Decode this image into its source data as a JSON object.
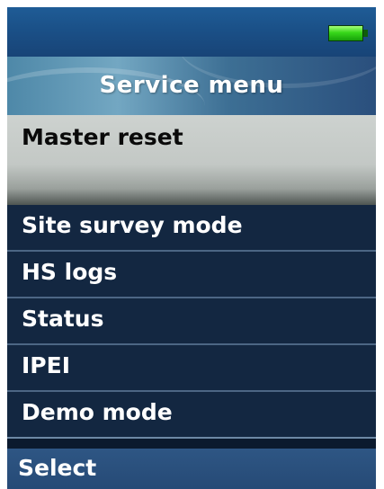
{
  "status_bar": {
    "battery_icon": "battery-full-icon",
    "battery_color": "#38d81a"
  },
  "title_bar": {
    "title": "Service menu"
  },
  "menu": {
    "selected": {
      "label": "Master reset"
    },
    "items": [
      {
        "label": "Site survey mode"
      },
      {
        "label": "HS logs"
      },
      {
        "label": "Status"
      },
      {
        "label": "IPEI"
      },
      {
        "label": "Demo mode"
      }
    ]
  },
  "softkeys": {
    "left": "Select"
  },
  "colors": {
    "screen_bg": "#0b1a2e",
    "item_bg": "#132741",
    "selected_bg": "#c3c8c5",
    "accent": "#1f5c96"
  }
}
